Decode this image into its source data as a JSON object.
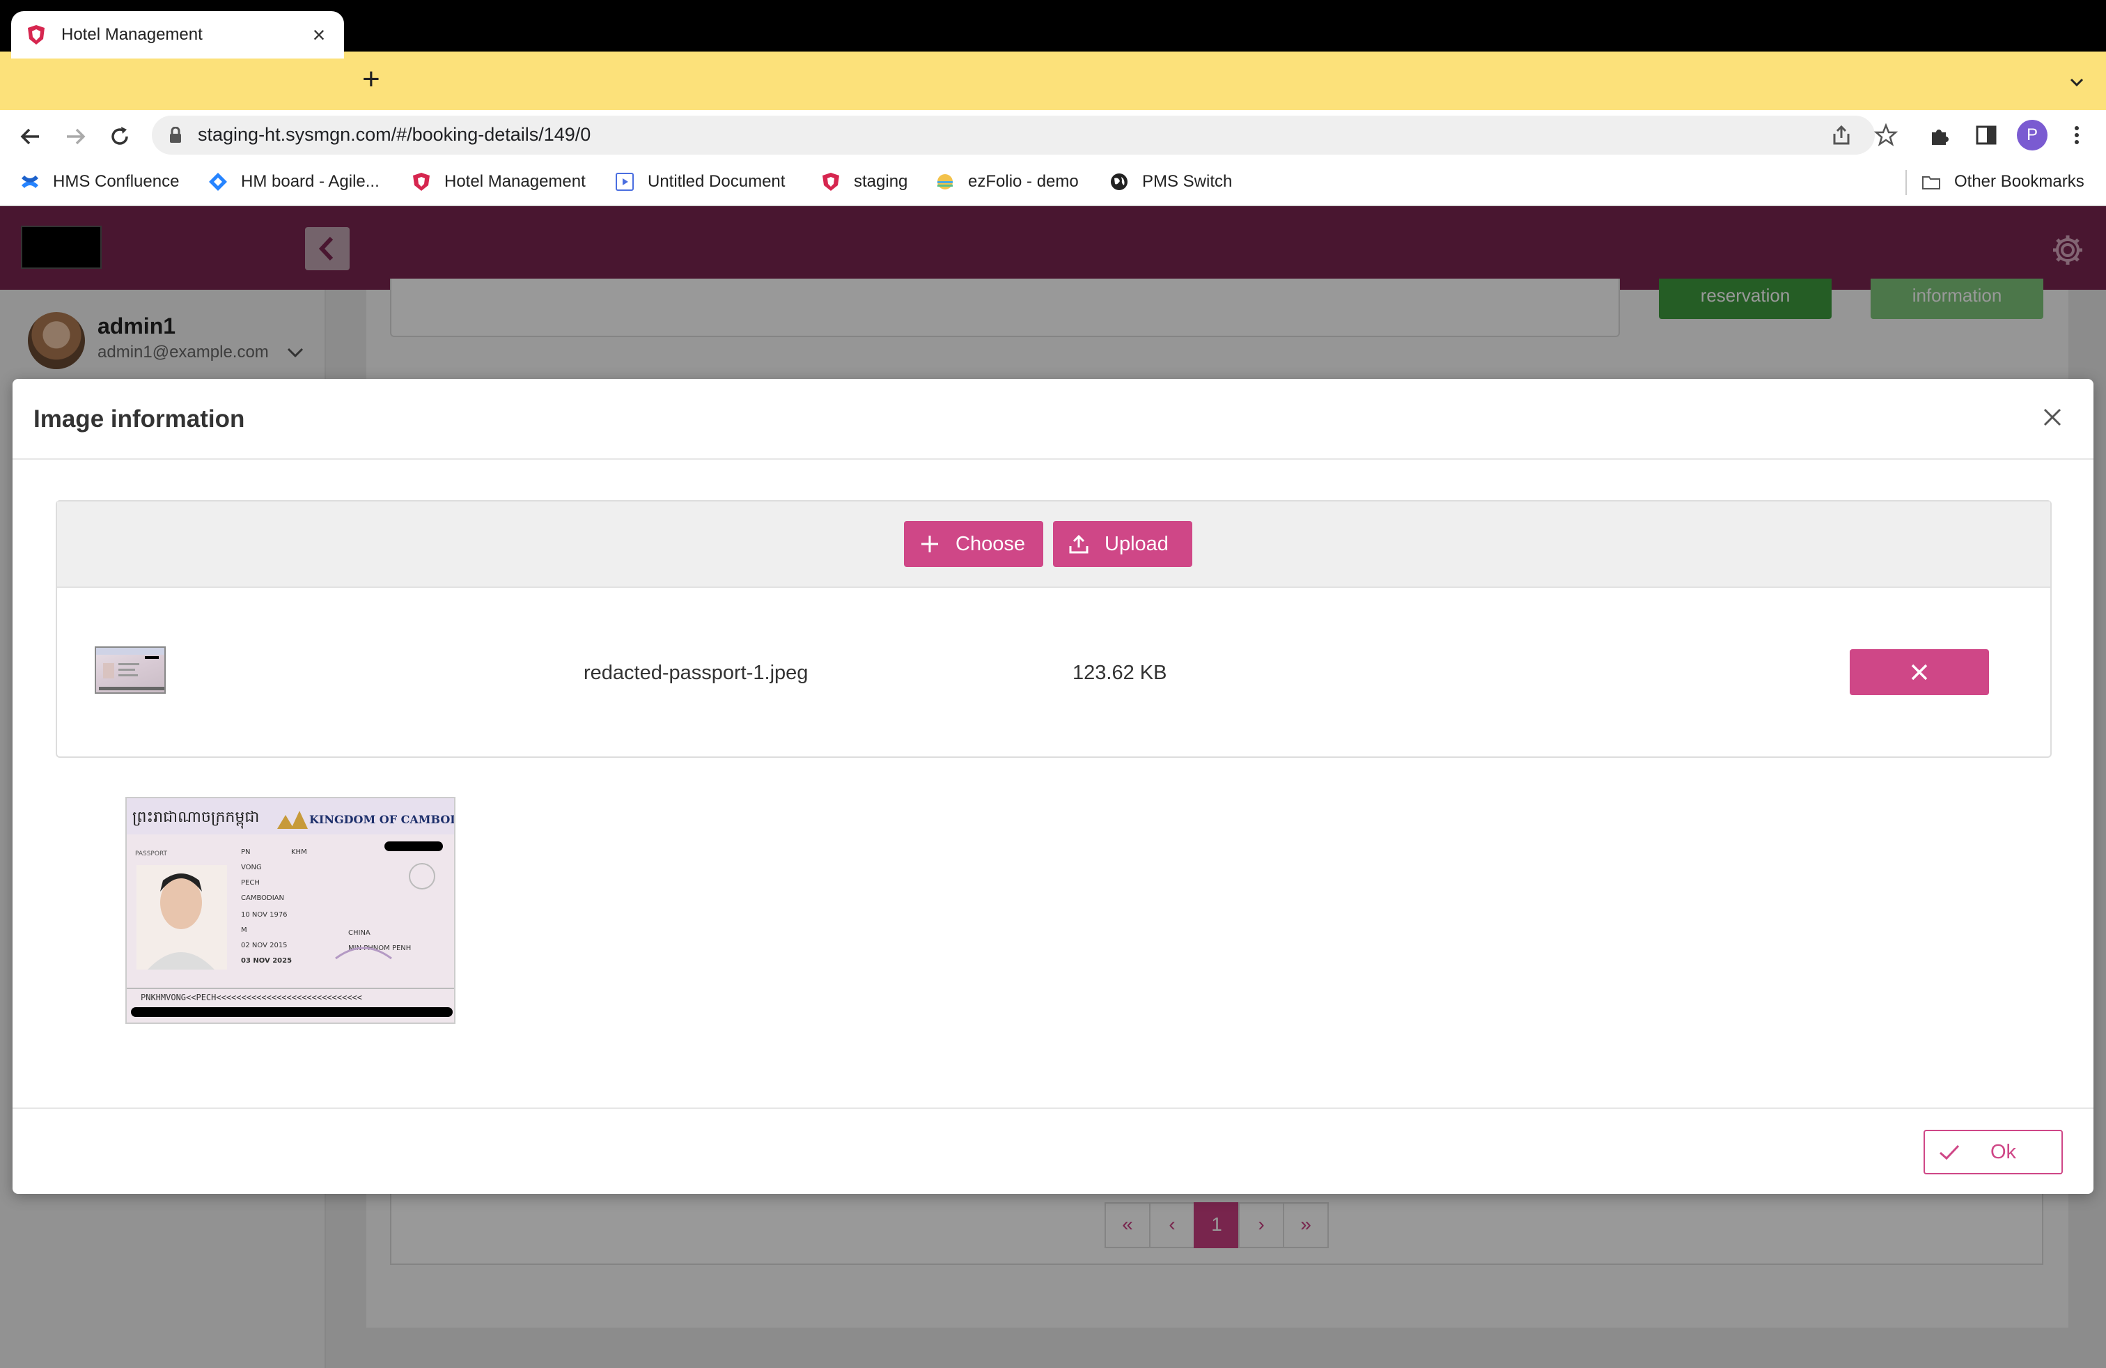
{
  "browser": {
    "tab_title": "Hotel Management",
    "url": "staging-ht.sysmgn.com/#/booking-details/149/0",
    "profile_initial": "P",
    "bookmarks": [
      {
        "label": "HMS Confluence",
        "icon": "confluence-icon"
      },
      {
        "label": "HM board - Agile...",
        "icon": "jira-icon"
      },
      {
        "label": "Hotel Management",
        "icon": "shield-icon"
      },
      {
        "label": "Untitled Document",
        "icon": "document-icon"
      },
      {
        "label": "staging",
        "icon": "shield-icon"
      },
      {
        "label": "ezFolio - demo",
        "icon": "ezfolio-icon"
      },
      {
        "label": "PMS Switch",
        "icon": "globe-icon"
      }
    ],
    "other_bookmarks": "Other Bookmarks"
  },
  "app": {
    "user_name": "admin1",
    "user_email": "admin1@example.com",
    "bg_button_1": "reservation",
    "bg_button_2": "information",
    "pagination": {
      "current": "1",
      "first": "«",
      "prev": "‹",
      "next": "›",
      "last": "»"
    },
    "colors": {
      "header": "#7a2650",
      "accent": "#cf4787",
      "green": "#3f9b3e"
    }
  },
  "modal": {
    "title": "Image information",
    "choose_label": "Choose",
    "upload_label": "Upload",
    "file": {
      "name": "redacted-passport-1.jpeg",
      "size": "123.62 KB"
    },
    "ok_label": "Ok",
    "passport": {
      "country_khmer": "ព្រះរាជាណាចក្រកម្ពុជា",
      "country": "KINGDOM OF CAMBODIA",
      "type_label": "PASSPORT",
      "type": "PN",
      "code": "KHM",
      "surname": "VONG",
      "given_name": "PECH",
      "nationality": "CAMBODIAN",
      "dob": "10 NOV 1976",
      "sex": "M",
      "issue_date": "02 NOV 2015",
      "expiry_date": "03 NOV 2025",
      "birthplace": "CHINA",
      "authority": "MIN PHNOM PENH",
      "mrz": "PNKHMVONG<<PECH<<<<<<<<<<<<<<<<<<<<<<<<<<<<<"
    }
  }
}
